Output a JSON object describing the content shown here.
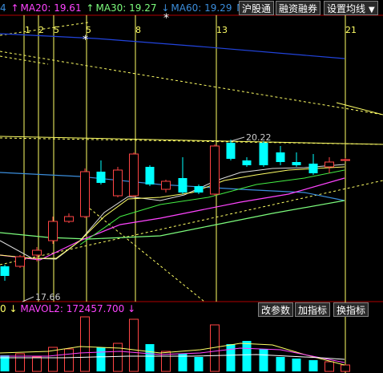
{
  "top_legend": {
    "prefix": "4",
    "items": [
      {
        "arrow": "↑",
        "text": "MA20: 19.61",
        "color": "#ff44ff"
      },
      {
        "arrow": "↑",
        "text": "MA30: 19.27",
        "color": "#7cfc7c"
      },
      {
        "arrow": "↓",
        "text": "MA60: 19.29",
        "color": "#3b8ddb"
      },
      {
        "arrow": "",
        "text": "MA",
        "color": "#3b8ddb"
      }
    ]
  },
  "toolbar": {
    "sh_index": "沪股通",
    "margin": "融资融券",
    "ma_settings": "设置均线"
  },
  "vertical_markers": [
    "1",
    "2",
    "5",
    "5",
    "8",
    "13",
    "21"
  ],
  "stars": [
    "*",
    "*"
  ],
  "price_labels": {
    "high": "20.22",
    "low": "17.66"
  },
  "volume_legend": {
    "prefix": "0",
    "arrow": "↓",
    "text": "MAVOL2: 172457.700",
    "arrow2": "↓"
  },
  "volume_toolbar": {
    "params": "改参数",
    "add_indicator": "加指标",
    "change_indicator": "换指标"
  },
  "chart_data": {
    "type": "candlestick",
    "title": "",
    "ma_series": [
      {
        "name": "MA20",
        "value": 19.61,
        "color": "#ff44ff"
      },
      {
        "name": "MA30",
        "value": 19.27,
        "color": "#7cfc7c"
      },
      {
        "name": "MA60",
        "value": 19.29,
        "color": "#3b8ddb"
      }
    ],
    "price_high": 20.22,
    "price_low": 17.66,
    "mavol2": 172457.7,
    "fib_markers": [
      1,
      2,
      5,
      5,
      8,
      13,
      21
    ],
    "colors": {
      "up": "#ff4444",
      "down": "#00ffff",
      "gold": "#ffff66",
      "bg": "#000000"
    }
  }
}
